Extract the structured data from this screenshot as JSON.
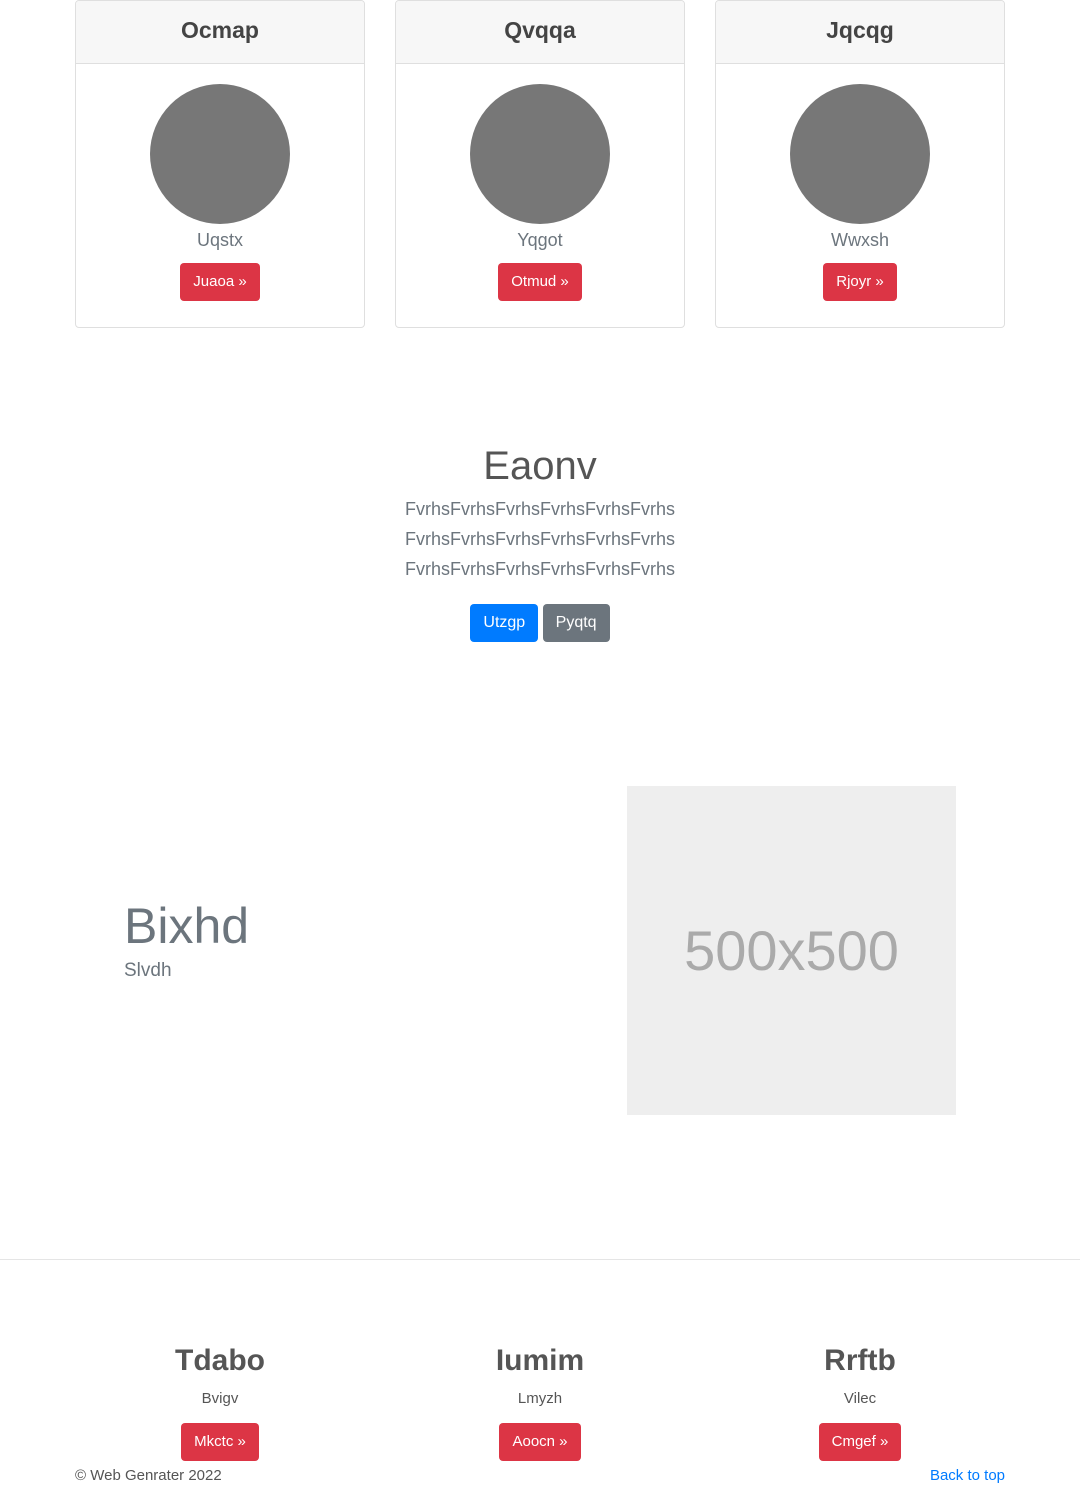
{
  "cards": [
    {
      "title": "Ocmap",
      "subtitle": "Uqstx",
      "button": "Juaoa »"
    },
    {
      "title": "Qvqqa",
      "subtitle": "Yqgot",
      "button": "Otmud »"
    },
    {
      "title": "Jqcqg",
      "subtitle": "Wwxsh",
      "button": "Rjoyr »"
    }
  ],
  "hero": {
    "title": "Eaonv",
    "text": "FvrhsFvrhsFvrhsFvrhsFvrhsFvrhs FvrhsFvrhsFvrhsFvrhsFvrhsFvrhs FvrhsFvrhsFvrhsFvrhsFvrhsFvrhs",
    "primary": "Utzgp",
    "secondary": "Pyqtq"
  },
  "feature": {
    "title": "Bixhd",
    "subtitle": "Slvdh",
    "placeholder": "500x500"
  },
  "columns": [
    {
      "title": "Tdabo",
      "subtitle": "Bvigv",
      "button": "Mkctc »"
    },
    {
      "title": "Iumim",
      "subtitle": "Lmyzh",
      "button": "Aoocn »"
    },
    {
      "title": "Rrftb",
      "subtitle": "Vilec",
      "button": "Cmgef »"
    }
  ],
  "footer": {
    "copyright": "© Web Genrater 2022",
    "back_to_top": "Back to top"
  }
}
